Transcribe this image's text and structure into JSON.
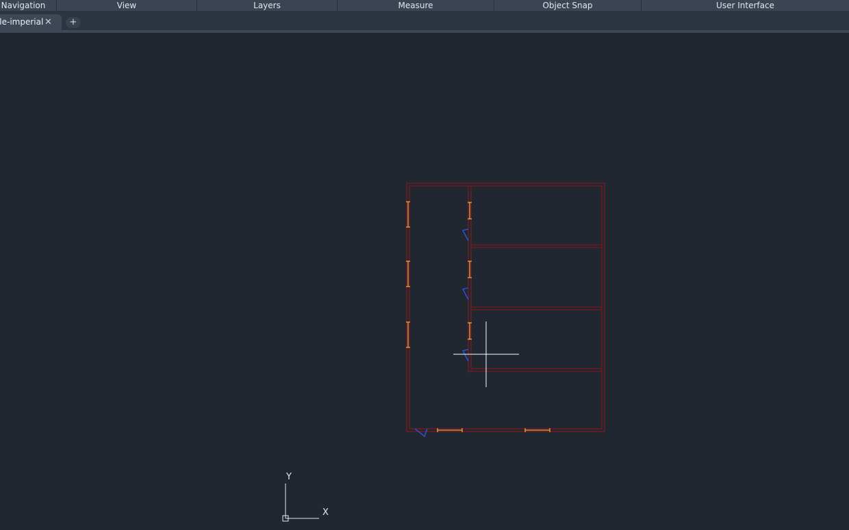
{
  "ribbon": {
    "groups": [
      {
        "label": "Navigation"
      },
      {
        "label": "View"
      },
      {
        "label": "Layers"
      },
      {
        "label": "Measure"
      },
      {
        "label": "Object Snap"
      },
      {
        "label": "User Interface"
      }
    ]
  },
  "tabs": {
    "active_label": "Sample-imperial",
    "close_glyph": "✕",
    "new_tab_glyph": "+"
  },
  "ucs": {
    "y_label": "Y",
    "x_label": "X"
  },
  "colors": {
    "background": "#212730",
    "walls": "#7a1a20",
    "windows": "#f0a040",
    "doors": "#2a55e0",
    "crosshair": "#ffffff"
  }
}
